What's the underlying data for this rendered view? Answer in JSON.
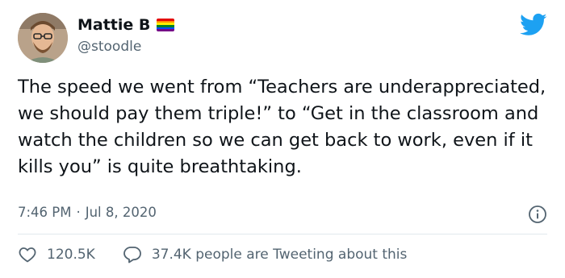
{
  "user": {
    "display_name": "Mattie B",
    "handle": "@stoodle",
    "avatar_icon": "user-avatar",
    "badge_icon": "rainbow-flag-icon",
    "flag_colors": [
      "#e40303",
      "#ff8c00",
      "#ffed00",
      "#008026",
      "#004dff",
      "#750787"
    ]
  },
  "brand": {
    "icon": "twitter-bird-icon",
    "color": "#1da1f2"
  },
  "tweet": {
    "text": "The speed we went from “Teachers are underappreciated, we should pay them triple!” to “Get in the classroom and watch the children so we can get back to work, even if it kills you” is quite breathtaking.",
    "time": "7:46 PM",
    "separator": "·",
    "date": "Jul 8, 2020"
  },
  "actions": {
    "likes": "120.5K",
    "tweeting": "37.4K people are Tweeting about this"
  },
  "colors": {
    "text": "#0f1419",
    "secondary": "#536471",
    "divider": "#e1e8ed"
  }
}
